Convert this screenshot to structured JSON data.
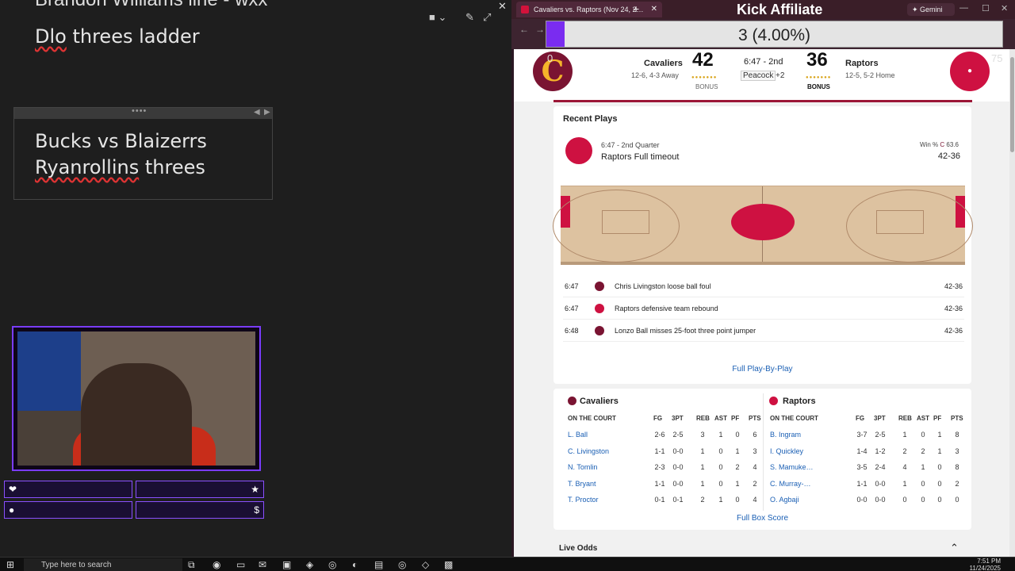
{
  "notes": {
    "cut_text": "Brandon Williams line - wxx",
    "line1": "Dlo threes ladder",
    "box_line1": "Bucks vs Blaizerrs",
    "box_line2": "Ryanrollins threes"
  },
  "stream_panels": {
    "heart_icon": "heart-icon",
    "star_icon": "star-icon",
    "drop_icon": "drop-icon",
    "dollar": "$"
  },
  "browser": {
    "tab_title": "Cavaliers vs. Raptors (Nov 24, 2…",
    "window_title": "Kick Affiliate",
    "gemini": "Gemini",
    "goal_text": "3 (4.00%)",
    "goal_pct": 0.04
  },
  "scoreboard": {
    "corner_left": "0",
    "corner_right": "75",
    "away": {
      "name": "Cavaliers",
      "record": "12-6, 4-3 Away",
      "score": "42",
      "bonus": "BONUS"
    },
    "home": {
      "name": "Raptors",
      "record": "12-5, 5-2 Home",
      "score": "36",
      "bonus": "BONUS"
    },
    "clock": "6:47 - 2nd",
    "network": "Peacock",
    "network_more": "+2"
  },
  "recent_plays": {
    "title": "Recent Plays",
    "hero": {
      "time": "6:47 - 2nd Quarter",
      "desc": "Raptors Full timeout",
      "win_label": "Win %",
      "win_value": "63.6",
      "score": "42-36"
    },
    "rows": [
      {
        "time": "6:47",
        "desc": "Chris Livingston loose ball foul",
        "score": "42-36",
        "team": "cavs"
      },
      {
        "time": "6:47",
        "desc": "Raptors defensive team rebound",
        "score": "42-36",
        "team": "raps"
      },
      {
        "time": "6:48",
        "desc": "Lonzo Ball misses 25-foot three point jumper",
        "score": "42-36",
        "team": "cavs"
      }
    ],
    "link": "Full Play-By-Play"
  },
  "box": {
    "cols": [
      "ON THE COURT",
      "FG",
      "3PT",
      "REB",
      "AST",
      "PF",
      "PTS"
    ],
    "away": {
      "team": "Cavaliers",
      "players": [
        {
          "name": "L. Ball",
          "fg": "2-6",
          "tp": "2-5",
          "reb": "3",
          "ast": "1",
          "pf": "0",
          "pts": "6"
        },
        {
          "name": "C. Livingston",
          "fg": "1-1",
          "tp": "0-0",
          "reb": "1",
          "ast": "0",
          "pf": "1",
          "pts": "3"
        },
        {
          "name": "N. Tomlin",
          "fg": "2-3",
          "tp": "0-0",
          "reb": "1",
          "ast": "0",
          "pf": "2",
          "pts": "4"
        },
        {
          "name": "T. Bryant",
          "fg": "1-1",
          "tp": "0-0",
          "reb": "1",
          "ast": "0",
          "pf": "1",
          "pts": "2"
        },
        {
          "name": "T. Proctor",
          "fg": "0-1",
          "tp": "0-1",
          "reb": "2",
          "ast": "1",
          "pf": "0",
          "pts": "4"
        }
      ]
    },
    "home": {
      "team": "Raptors",
      "players": [
        {
          "name": "B. Ingram",
          "fg": "3-7",
          "tp": "2-5",
          "reb": "1",
          "ast": "0",
          "pf": "1",
          "pts": "8"
        },
        {
          "name": "I. Quickley",
          "fg": "1-4",
          "tp": "1-2",
          "reb": "2",
          "ast": "2",
          "pf": "1",
          "pts": "3"
        },
        {
          "name": "S. Mamuke…",
          "fg": "3-5",
          "tp": "2-4",
          "reb": "4",
          "ast": "1",
          "pf": "0",
          "pts": "8"
        },
        {
          "name": "C. Murray-…",
          "fg": "1-1",
          "tp": "0-0",
          "reb": "1",
          "ast": "0",
          "pf": "0",
          "pts": "2"
        },
        {
          "name": "O. Agbaji",
          "fg": "0-0",
          "tp": "0-0",
          "reb": "0",
          "ast": "0",
          "pf": "0",
          "pts": "0"
        }
      ]
    },
    "link": "Full Box Score"
  },
  "live_odds": "Live Odds",
  "taskbar": {
    "search": "Type here to search",
    "time": "7:51 PM",
    "date": "11/24/2025"
  },
  "colors": {
    "cavs": "#7a1432",
    "raps": "#ce1141",
    "accent": "#7a2cf0"
  }
}
